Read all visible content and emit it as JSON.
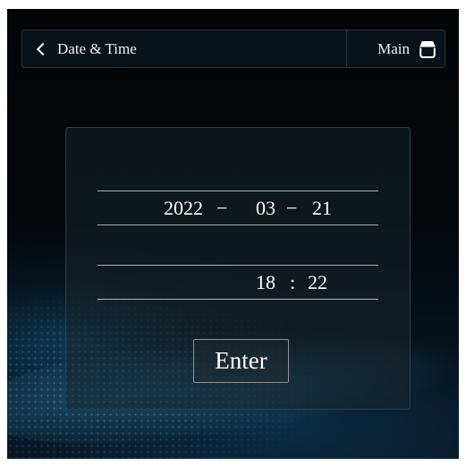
{
  "top_bar": {
    "back_icon": "chevron-left-icon",
    "title": "Date & Time",
    "main_label": "Main",
    "main_icon": "home-icon"
  },
  "date": {
    "year": "2022",
    "month": "03",
    "day": "21",
    "separator": "−"
  },
  "time": {
    "hour": "18",
    "minute": "22",
    "separator": ":"
  },
  "enter_label": "Enter",
  "colors": {
    "background": "#04070a",
    "panel_border": "#2a3d4a",
    "accent_glow": "#3c96c8",
    "text": "#ffffff"
  }
}
